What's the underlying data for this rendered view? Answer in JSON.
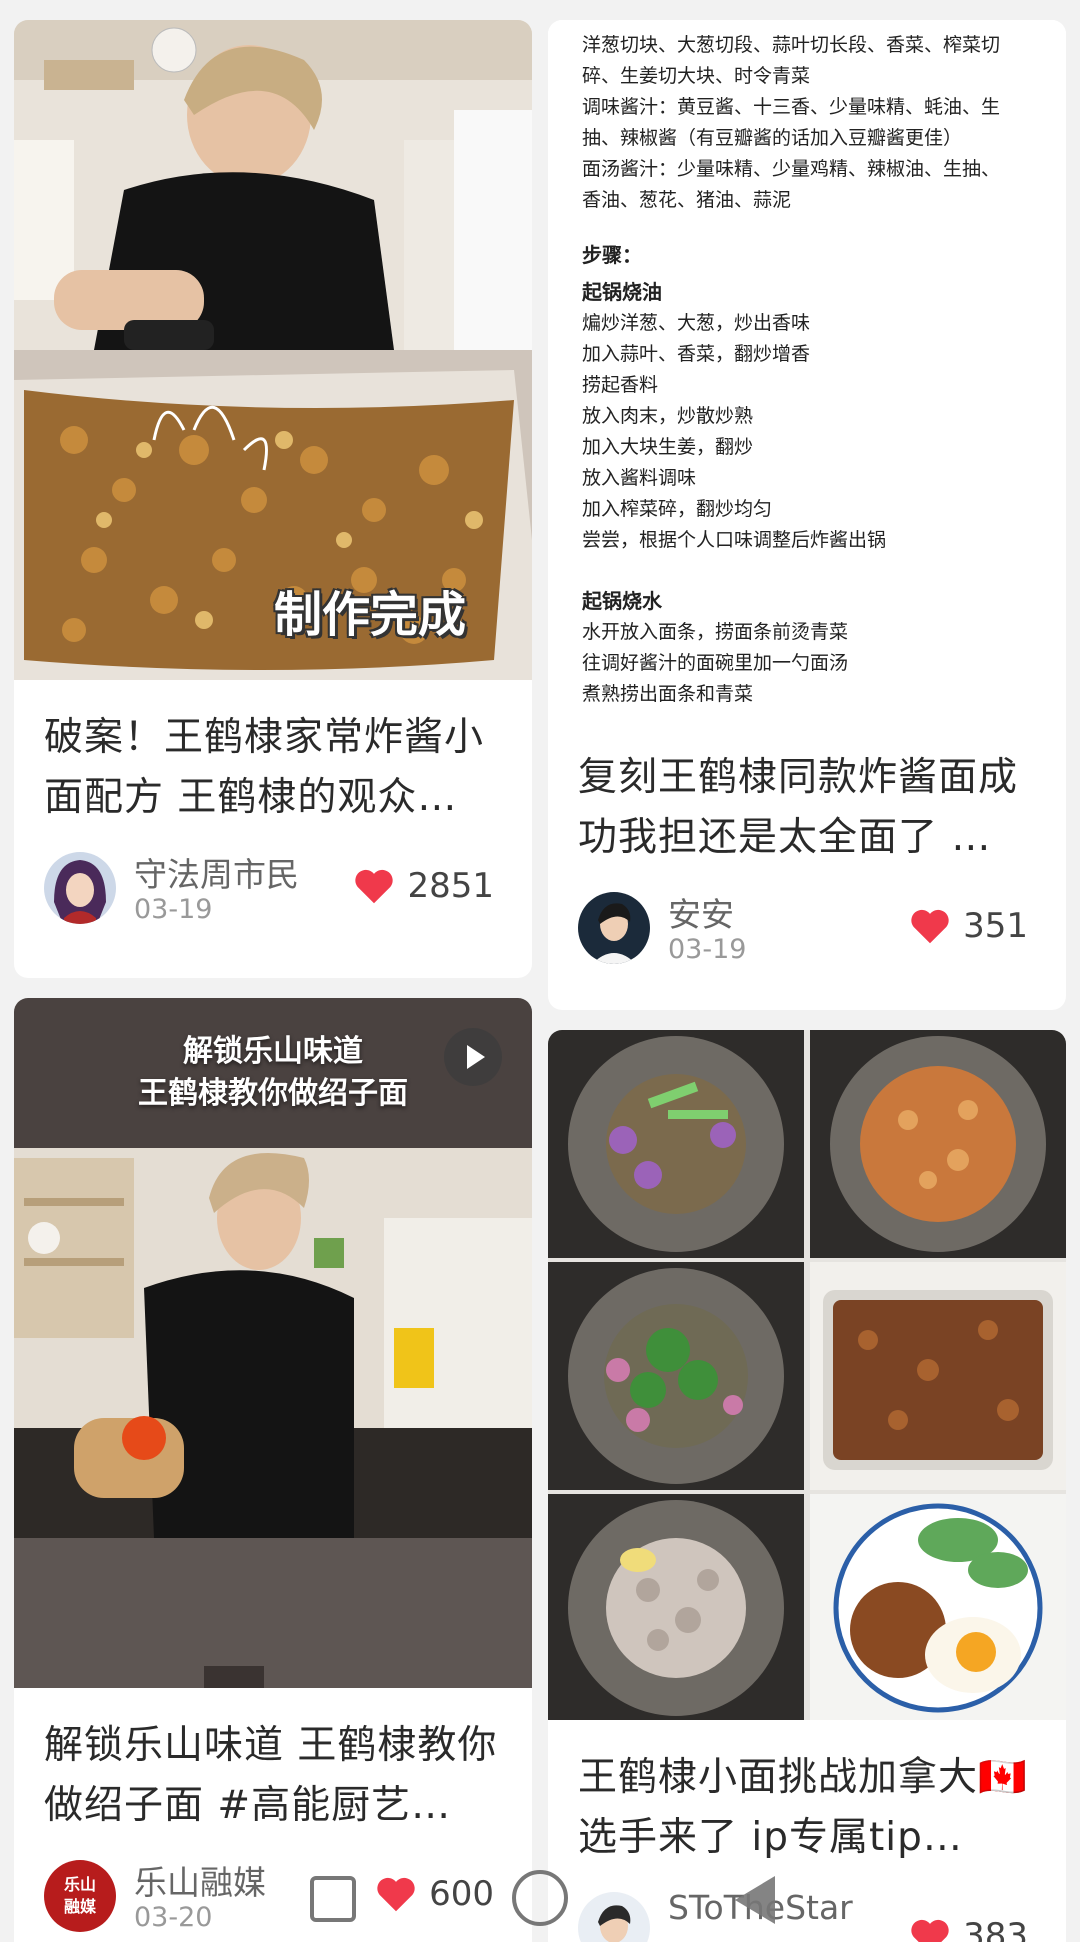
{
  "feed": {
    "cards": [
      {
        "title": "破案！王鹤棣家常炸酱小面配方 王鹤棣的观众…",
        "image_caption": "制作完成",
        "author": "守法周市民",
        "date": "03-19",
        "likes": "2851"
      },
      {
        "title": "复刻王鹤棣同款炸酱面成功我担还是太全面了 …",
        "author": "安安",
        "date": "03-19",
        "likes": "351",
        "recipe_lines": [
          "洋葱切块、大葱切段、蒜叶切长段、香菜、榨菜切",
          "碎、生姜切大块、时令青菜",
          "调味酱汁：黄豆酱、十三香、少量味精、蚝油、生",
          "抽、辣椒酱（有豆瓣酱的话加入豆瓣酱更佳）",
          "面汤酱汁：少量味精、少量鸡精、辣椒油、生抽、",
          "香油、葱花、猪油、蒜泥"
        ],
        "steps_heading": "步骤：",
        "section1_heading": "起锅烧油",
        "section1_lines": [
          "煸炒洋葱、大葱，炒出香味",
          "加入蒜叶、香菜，翻炒增香",
          "捞起香料",
          "放入肉末，炒散炒熟",
          "加入大块生姜，翻炒",
          "放入酱料调味",
          "加入榨菜碎，翻炒均匀",
          "尝尝，根据个人口味调整后炸酱出锅"
        ],
        "section2_heading": "起锅烧水",
        "section2_lines": [
          "水开放入面条，捞面条前烫青菜",
          "往调好酱汁的面碗里加一勺面汤",
          "煮熟捞出面条和青菜"
        ]
      },
      {
        "title": "解锁乐山味道 王鹤棣教你做绍子面 #高能厨艺…",
        "video_caption_line1": "解锁乐山味道",
        "video_caption_line2": "王鹤棣教你做绍子面",
        "author": "乐山融媒",
        "avatar_text": "乐山融媒",
        "date": "03-20",
        "likes": "600"
      },
      {
        "title": "王鹤棣小面挑战加拿大🇨🇦选手来了 ip专属tip…",
        "author": "SToTheStar",
        "likes": "383"
      }
    ]
  },
  "colors": {
    "heart": "#f0394b",
    "background": "#f2f2f2"
  }
}
